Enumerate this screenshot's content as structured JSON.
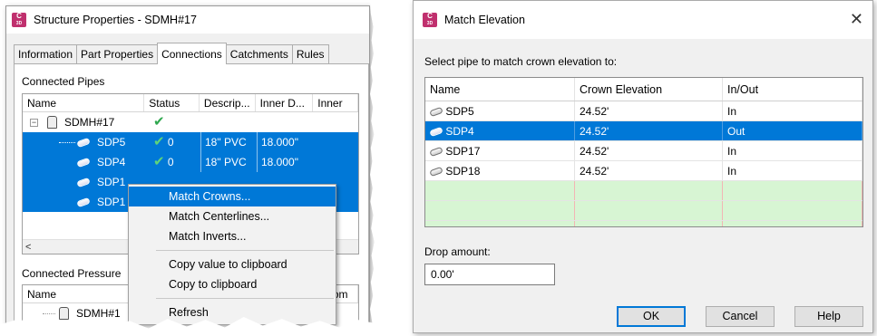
{
  "left_dialog": {
    "app_icon_text": "C3D",
    "title": "Structure Properties - SDMH#17",
    "tabs": [
      "Information",
      "Part Properties",
      "Connections",
      "Catchments",
      "Rules"
    ],
    "active_tab": "Connections",
    "connected_pipes": {
      "label": "Connected Pipes",
      "columns": [
        "Name",
        "Status",
        "Descrip...",
        "Inner D...",
        "Inner"
      ],
      "structure": {
        "name": "SDMH#17",
        "status": "✔"
      },
      "rows": [
        {
          "name": "SDP5",
          "status": "0",
          "description": "18\" PVC",
          "inner_diameter": "18.000\""
        },
        {
          "name": "SDP4",
          "status": "0",
          "description": "18\" PVC",
          "inner_diameter": "18.000\""
        },
        {
          "name": "SDP1",
          "status": "",
          "description": "",
          "inner_diameter": ""
        },
        {
          "name": "SDP1",
          "status": "",
          "description": "",
          "inner_diameter": ""
        }
      ],
      "scroll_left": "<"
    },
    "connected_pressure": {
      "label": "Connected Pressure",
      "columns": [
        "Name",
        "Nom"
      ],
      "structure": {
        "name": "SDMH#1"
      }
    }
  },
  "context_menu": {
    "items": [
      "Match Crowns...",
      "Match Centerlines...",
      "Match Inverts...",
      "Copy value to clipboard",
      "Copy to clipboard",
      "Refresh"
    ],
    "highlighted": "Match Crowns..."
  },
  "right_dialog": {
    "app_icon_text": "C3D",
    "title": "Match Elevation",
    "close": "✕",
    "prompt": "Select pipe to match crown elevation to:",
    "columns": [
      "Name",
      "Crown Elevation",
      "In/Out"
    ],
    "rows": [
      {
        "name": "SDP5",
        "crown": "24.52'",
        "inout": "In"
      },
      {
        "name": "SDP4",
        "crown": "24.52'",
        "inout": "Out"
      },
      {
        "name": "SDP17",
        "crown": "24.52'",
        "inout": "In"
      },
      {
        "name": "SDP18",
        "crown": "24.52'",
        "inout": "In"
      }
    ],
    "selected_row": "SDP4",
    "drop_label": "Drop amount:",
    "drop_value": "0.00'",
    "buttons": {
      "ok": "OK",
      "cancel": "Cancel",
      "help": "Help"
    }
  }
}
